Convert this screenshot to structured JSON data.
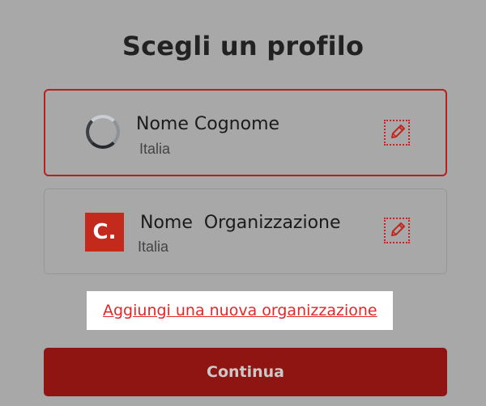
{
  "header": {
    "title": "Scegli un profilo"
  },
  "profiles": [
    {
      "name": "Nome Cognome",
      "country": "Italia",
      "selected": true
    },
    {
      "name": "Nome  Organizzazione",
      "country": "Italia",
      "logo_text": "C.",
      "selected": false
    }
  ],
  "actions": {
    "add_organization_label": "Aggiungi una nuova organizzazione",
    "continue_label": "Continua"
  },
  "colors": {
    "accent": "#c0281f",
    "continue_bg": "#8f1513",
    "link": "#e3262a",
    "backdrop": "#a8a8a8"
  },
  "icons": {
    "edit": "pencil-icon",
    "avatar": "avatar-ring-icon"
  }
}
